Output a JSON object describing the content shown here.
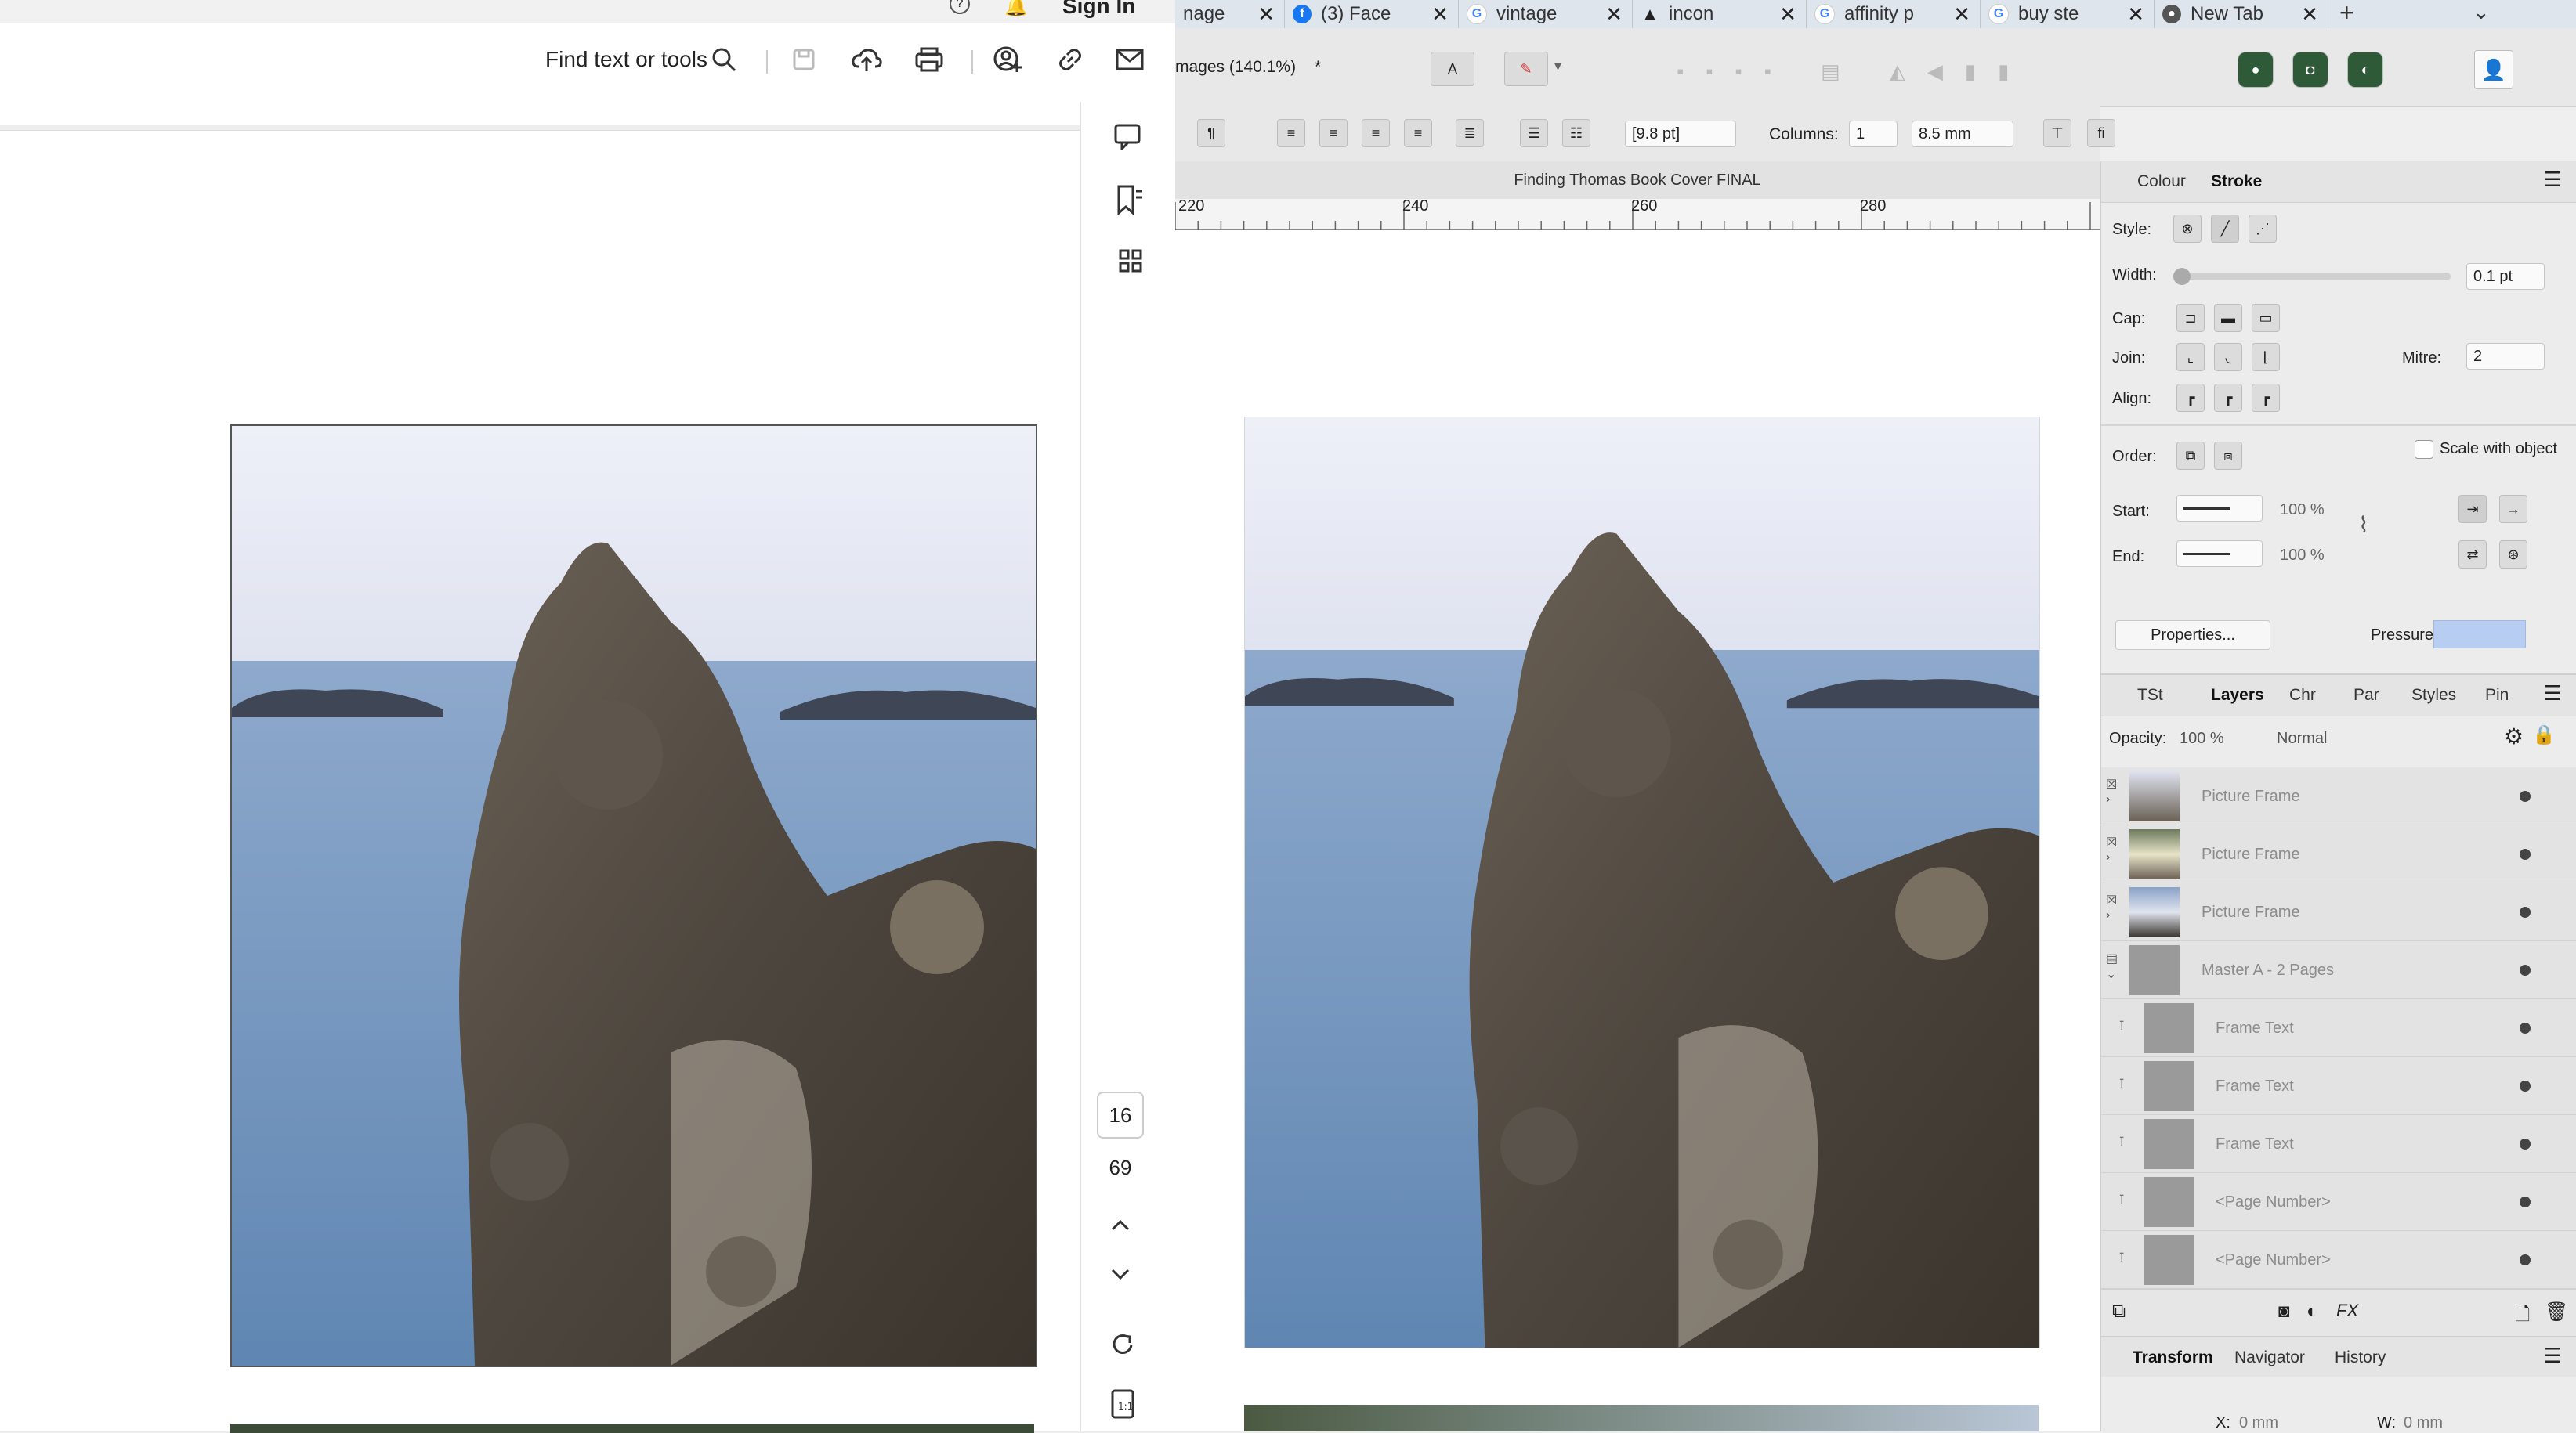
{
  "pdf": {
    "sign_in": "Sign In",
    "search_label": "Find text or tools",
    "page_current": "16",
    "page_total": "69"
  },
  "browser_tabs": [
    {
      "label": "nage",
      "favicon": "image-icon",
      "color": "#999999"
    },
    {
      "label": "(3) Face",
      "favicon": "facebook-icon",
      "color": "#1877f2"
    },
    {
      "label": "vintage",
      "favicon": "google-icon",
      "color": "#4285f4"
    },
    {
      "label": "incon",
      "favicon": "triangle-icon",
      "color": "#222222"
    },
    {
      "label": "affinity p",
      "favicon": "google-icon",
      "color": "#4285f4"
    },
    {
      "label": "buy ste",
      "favicon": "google-icon",
      "color": "#4285f4"
    },
    {
      "label": "New Tab",
      "favicon": "chrome-icon",
      "color": "#555555"
    }
  ],
  "affinity": {
    "doc_tab": "mages (140.1%)",
    "doc_tab_close": "*",
    "font_size": "[9.8 pt]",
    "columns_label": "Columns:",
    "columns_value": "1",
    "gutter_value": "8.5 mm",
    "doc_title": "Finding Thomas Book Cover FINAL",
    "ruler_ticks": [
      "220",
      "240",
      "260",
      "280"
    ],
    "stroke_panel": {
      "tabs": [
        "Colour",
        "Stroke"
      ],
      "active_tab": "Stroke",
      "style_label": "Style:",
      "width_label": "Width:",
      "width_value": "0.1 pt",
      "cap_label": "Cap:",
      "join_label": "Join:",
      "mitre_label": "Mitre:",
      "mitre_value": "2",
      "align_label": "Align:",
      "order_label": "Order:",
      "scale_label": "Scale with object",
      "start_label": "Start:",
      "start_value": "100 %",
      "end_label": "End:",
      "end_value": "100 %",
      "properties_button": "Properties...",
      "pressure_label": "Pressure:"
    },
    "layers_panel": {
      "tabs": [
        "TSt",
        "Layers",
        "Chr",
        "Par",
        "Styles",
        "Pin"
      ],
      "active_tab": "Layers",
      "opacity_label": "Opacity:",
      "opacity_value": "100 %",
      "blend_mode": "Normal",
      "layers": [
        {
          "name": "Picture Frame"
        },
        {
          "name": "Picture Frame"
        },
        {
          "name": "Picture Frame"
        },
        {
          "name": "Master A - 2 Pages"
        },
        {
          "name": "Frame Text"
        },
        {
          "name": "Frame Text"
        },
        {
          "name": "Frame Text"
        },
        {
          "name": "<Page Number>"
        },
        {
          "name": "<Page Number>"
        }
      ]
    },
    "bottom_tabs": [
      "Transform",
      "Navigator",
      "History"
    ],
    "bottom_active": "Transform",
    "transform": {
      "x_label": "X:",
      "x_value": "0 mm",
      "w_label": "W:",
      "w_value": "0 mm"
    }
  }
}
